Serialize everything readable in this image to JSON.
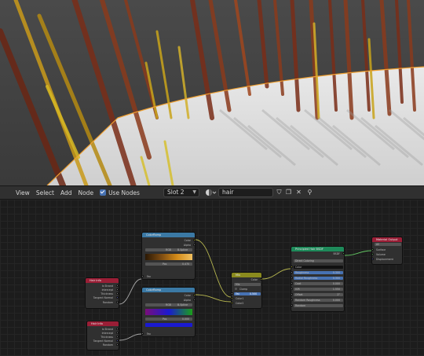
{
  "header": {
    "menu": [
      "View",
      "Select",
      "Add",
      "Node"
    ],
    "use_nodes_label": "Use Nodes",
    "use_nodes_checked": true,
    "slot_value": "Slot 2",
    "material_name": "hair"
  },
  "nodes": {
    "hair_info_1": {
      "title": "Hair Info",
      "outputs": [
        "Is Strand",
        "Intercept",
        "Thickness",
        "Tangent Normal",
        "Random"
      ]
    },
    "hair_info_2": {
      "title": "Hair Info",
      "outputs": [
        "Is Strand",
        "Intercept",
        "Thickness",
        "Tangent Normal",
        "Random"
      ]
    },
    "color_ramp_1": {
      "title": "ColorRamp",
      "outputs": [
        "Color",
        "Alpha"
      ],
      "mode": "RGB",
      "interp": "B-Spline",
      "pos_label": "Pos",
      "pos_value": "0.470",
      "input": "Fac",
      "ramp_colors": [
        "#2a1804",
        "#7a4a12",
        "#d28a18",
        "#f0c060"
      ]
    },
    "color_ramp_2": {
      "title": "ColorRamp",
      "outputs": [
        "Color",
        "Alpha"
      ],
      "mode": "RGB",
      "interp": "B-Spline",
      "pos_label": "Pos",
      "pos_value": "0.000",
      "input": "Fac",
      "ramp_colors": [
        "#7a0d7a",
        "#1a1ad0",
        "#1aa01a"
      ]
    },
    "mix": {
      "title": "Mix",
      "outputs": [
        "Color"
      ],
      "mode": "Mix",
      "clamp_label": "Clamp",
      "fac_label": "Fac",
      "fac_value": "0.500",
      "inputs": [
        "Color1",
        "Color2"
      ]
    },
    "principled_hair": {
      "title": "Principled Hair BSDF",
      "output": "BSDF",
      "parametrization": "Direct Coloring",
      "rows": [
        "Color",
        "Roughness",
        "Radial Roughness",
        "Coat",
        "IOR",
        "Offset",
        "Random Roughness",
        "Random"
      ],
      "values": [
        "",
        "0.300",
        "0.300",
        "0.000",
        "1.550",
        "2°",
        "0.000",
        ""
      ]
    },
    "material_output": {
      "title": "Material Output",
      "target": "All",
      "inputs": [
        "Surface",
        "Volume",
        "Displacement"
      ]
    }
  },
  "colors": {
    "header_bg": "#303030",
    "accent": "#4772b3",
    "selection": "#f0a030",
    "input_header": "#9a1e36",
    "converter_header": "#3b79a5",
    "shader_header": "#1e8a5a",
    "mix_header": "#8a8a1e",
    "output_header": "#9a1e36"
  },
  "icons": [
    "checkbox-icon",
    "sphere-material-icon",
    "shield-icon",
    "duplicate-icon",
    "close-icon",
    "pin-icon"
  ]
}
